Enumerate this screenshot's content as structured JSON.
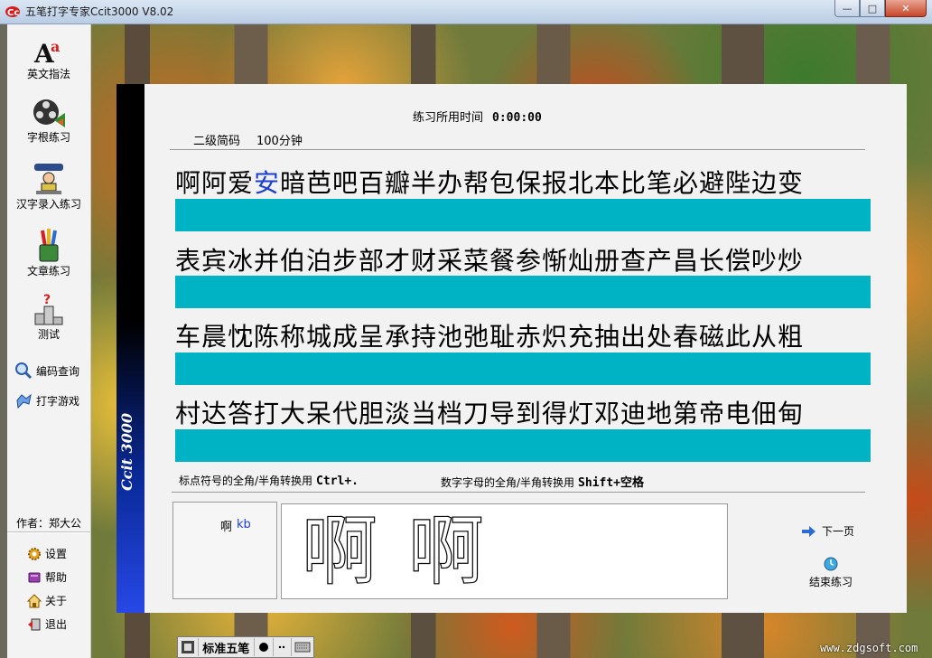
{
  "window": {
    "title": "五笔打字专家Ccit3000 V8.02",
    "buttons": {
      "minimize": "—",
      "maximize": "□",
      "close": "✕"
    }
  },
  "sidebar": {
    "big_items": [
      {
        "label": "英文指法",
        "icon": "english-letters-icon"
      },
      {
        "label": "字根练习",
        "icon": "film-reel-icon"
      },
      {
        "label": "汉字录入练习",
        "icon": "typist-icon"
      },
      {
        "label": "文章练习",
        "icon": "pens-cup-icon"
      },
      {
        "label": "测试",
        "icon": "podium-icon"
      }
    ],
    "small_items": [
      {
        "label": "编码查询",
        "icon": "magnifier-icon"
      },
      {
        "label": "打字游戏",
        "icon": "gamepad-icon"
      }
    ],
    "author": "作者：郑大公",
    "bottom_items": [
      {
        "label": "设置",
        "icon": "gear-icon"
      },
      {
        "label": "帮助",
        "icon": "book-icon"
      },
      {
        "label": "关于",
        "icon": "home-icon"
      },
      {
        "label": "退出",
        "icon": "exit-icon"
      }
    ]
  },
  "panel": {
    "brand_strip": "Ccit 3000",
    "time_label": "练习所用时间",
    "time_value": "0:00:00",
    "level": "二级简码",
    "duration": "100分钟",
    "rows": [
      {
        "before": "啊阿爱",
        "current": "安",
        "after": "暗芭吧百瓣半办帮包保报北本比笔必避陛边变"
      },
      {
        "before": "",
        "current": "",
        "after": "表宾冰并伯泊步部才财采菜餐参惭灿册查产昌长偿吵炒"
      },
      {
        "before": "",
        "current": "",
        "after": "车晨忱陈称城成呈承持池弛耻赤炽充抽出处春磁此从粗"
      },
      {
        "before": "",
        "current": "",
        "after": "村达答打大呆代胆淡当档刀导到得灯邓迪地第帝电佃甸"
      }
    ],
    "hint1_label": "标点符号的全角/半角转换用",
    "hint1_key": "Ctrl+.",
    "hint2_label": "数字字母的全角/半角转换用",
    "hint2_key": "Shift+空格",
    "code_char": "啊",
    "code_key": "kb",
    "display_char_1": "啊",
    "display_char_2": "啊",
    "next_label": "下一页",
    "end_label": "结束练习"
  },
  "ime": {
    "logo_icon": "ime-logo-icon",
    "name": "标准五笔",
    "mode_icon": "full-width-icon",
    "punct_icon": "punctuation-icon",
    "kbd_icon": "keyboard-icon"
  },
  "watermark": "www.zdgsoft.com",
  "colors": {
    "bar": "#00b3c4",
    "highlight": "#1b3fd0",
    "strip_top": "#000000",
    "strip_bottom": "#2748e6"
  }
}
